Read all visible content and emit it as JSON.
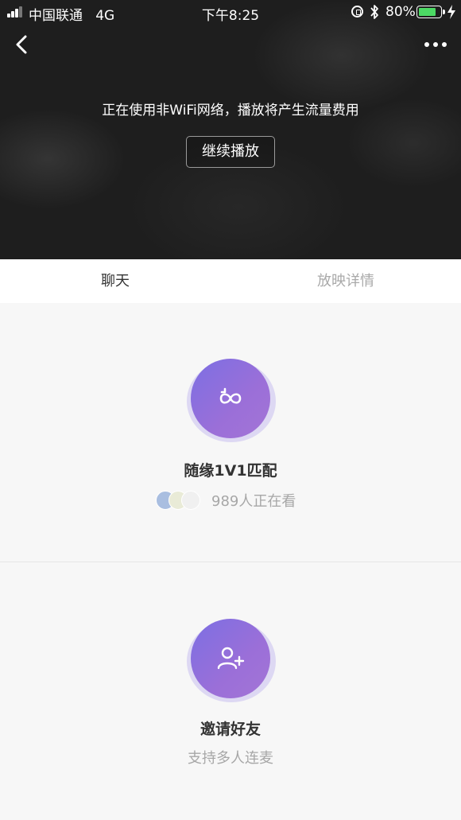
{
  "status_bar": {
    "carrier": "中国联通",
    "network": "4G",
    "time": "下午8:25",
    "battery_percent": "80%",
    "battery_level": 0.8,
    "battery_color": "#4cd964"
  },
  "video": {
    "notice": "正在使用非WiFi网络，播放将产生流量费用",
    "continue_label": "继续播放",
    "back_icon": "chevron-left-icon",
    "more_icon": "more-dots-icon"
  },
  "tabs": [
    {
      "label": "聊天",
      "active": true
    },
    {
      "label": "放映详情",
      "active": false
    }
  ],
  "random_match": {
    "icon": "infinity-loop-icon",
    "title": "随缘1V1匹配",
    "watching_text": "989人正在看"
  },
  "invite": {
    "icon": "add-user-icon",
    "title": "邀请好友",
    "subtitle": "支持多人连麦"
  },
  "colors": {
    "accent_start": "#7c6fe3",
    "accent_end": "#a375d6",
    "halo": "#ddd8f3"
  }
}
